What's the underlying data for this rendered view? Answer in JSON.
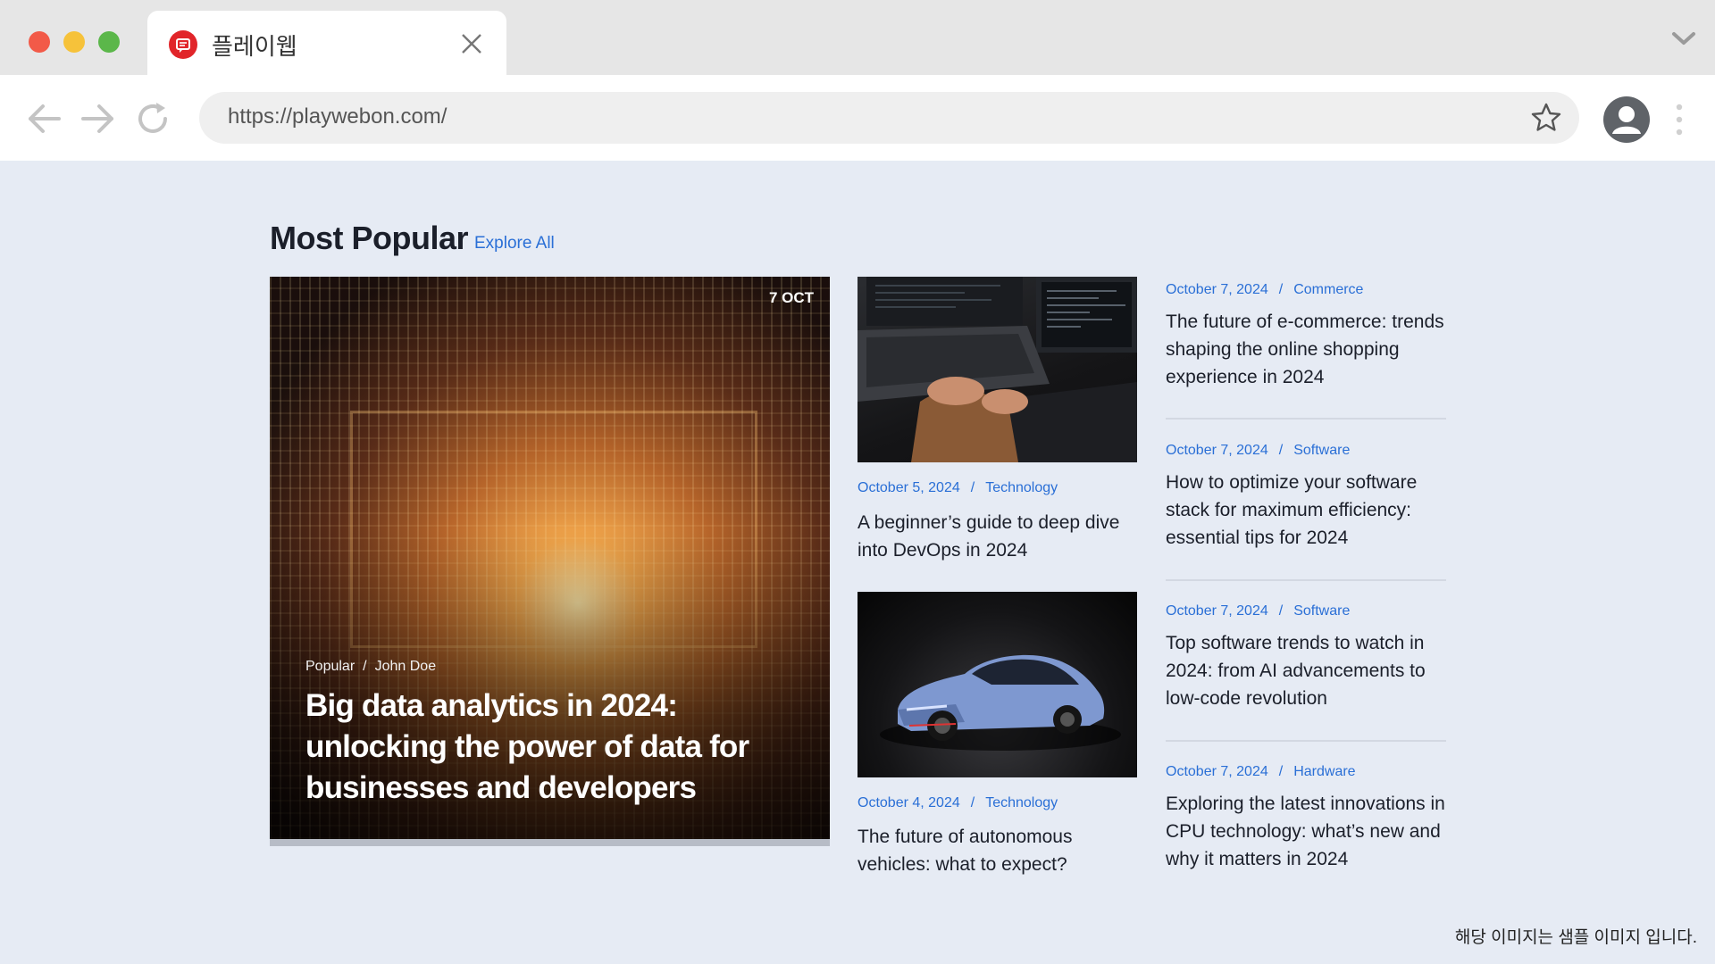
{
  "browser": {
    "tab_title": "플레이웹",
    "url": "https://playwebon.com/"
  },
  "colors": {
    "accent": "#2a6fd6",
    "favicon": "#e1252a",
    "page_background": "#e6ebf4"
  },
  "icons": [
    "back-arrow-icon",
    "forward-arrow-icon",
    "reload-icon",
    "star-icon",
    "account-icon",
    "more-menu-icon",
    "close-icon",
    "chevron-down-icon"
  ],
  "section": {
    "title": "Most Popular",
    "explore_label": "Explore All"
  },
  "featured": {
    "date_badge": "7 OCT",
    "category": "Popular",
    "separator": "/",
    "author": "John Doe",
    "title": "Big data analytics in 2024: unlocking the power of data for businesses and developers"
  },
  "middle": [
    {
      "date": "October 5, 2024",
      "separator": "/",
      "category": "Technology",
      "title": "A beginner’s guide to deep dive into DevOps in 2024"
    },
    {
      "date": "October 4, 2024",
      "separator": "/",
      "category": "Technology",
      "title": "The future of autonomous vehicles: what to expect?"
    }
  ],
  "list": [
    {
      "date": "October 7, 2024",
      "separator": "/",
      "category": "Commerce",
      "title": "The future of e-commerce: trends shaping the online shopping experience in 2024"
    },
    {
      "date": "October 7, 2024",
      "separator": "/",
      "category": "Software",
      "title": "How to optimize your software stack for maximum efficiency: essential tips for 2024"
    },
    {
      "date": "October 7, 2024",
      "separator": "/",
      "category": "Software",
      "title": "Top software trends to watch in 2024: from AI advancements to low-code revolution"
    },
    {
      "date": "October 7, 2024",
      "separator": "/",
      "category": "Hardware",
      "title": "Exploring the latest innovations in CPU technology: what’s new and why it matters in 2024"
    }
  ],
  "footer_note": "해당 이미지는 샘플 이미지 입니다."
}
